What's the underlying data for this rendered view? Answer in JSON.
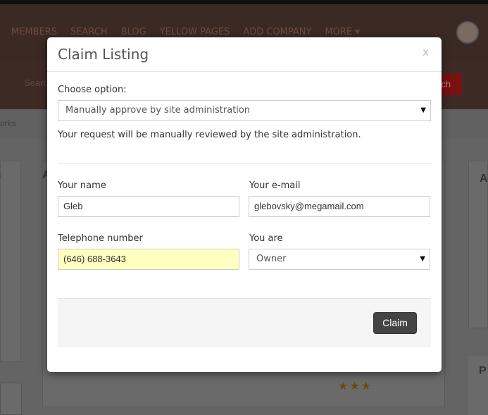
{
  "background": {
    "nav_items": [
      "MEMBERS",
      "SEARCH",
      "BLOG",
      "YELLOW PAGES",
      "ADD COMPANY",
      "MORE ▾"
    ],
    "search_placeholder": "Search",
    "search_button": "rch",
    "breadcrumb_fragment": "orks",
    "right_letter_a": "A",
    "right_letter_p": "P",
    "mid_letter": "A",
    "stars": "★★★"
  },
  "modal": {
    "title": "Claim Listing",
    "close_label": "x",
    "choose_option_label": "Choose option:",
    "choose_option_value": "Manually approve by site administration",
    "note": "Your request will be manually reviewed by the site administration.",
    "name_label": "Your name",
    "name_value": "Gleb",
    "email_label": "Your e-mail",
    "email_value": "glebovsky@megamail.com",
    "phone_label": "Telephone number",
    "phone_value": "(646) 688-3643",
    "phone_highlight": "#ffffc0",
    "you_are_label": "You are",
    "you_are_value": "Owner",
    "claim_button": "Claim"
  }
}
